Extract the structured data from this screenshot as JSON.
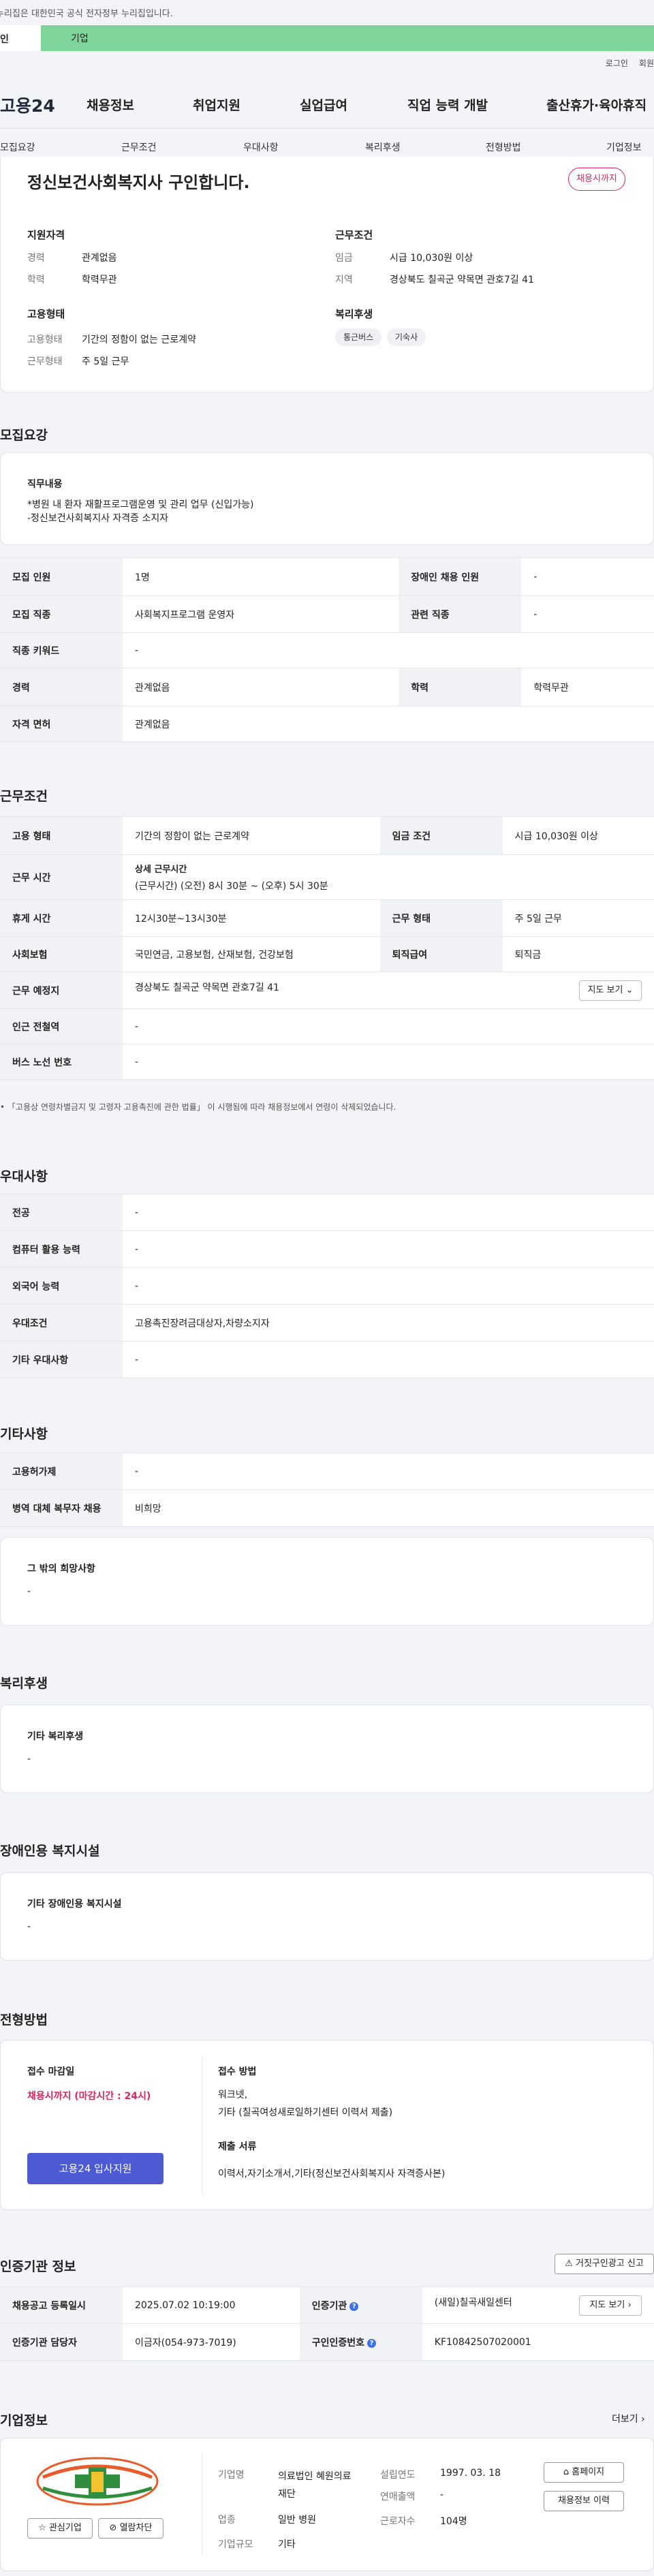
{
  "gov_banner": "이 누리집은 대한민국 공식 전자정부 누리집입니다.",
  "gov_banner_visible": "누리집은 대한민국 공식 전자정부 누리집입니다.",
  "top_tabs": [
    "인",
    "기업"
  ],
  "util": [
    "로그인",
    "회원"
  ],
  "logo": "고용24",
  "gnb": [
    "채용정보",
    "취업지원",
    "실업급여",
    "직업 능력 개발",
    "출산휴가·육아휴직"
  ],
  "subnav": [
    "모집요강",
    "근무조건",
    "우대사항",
    "복리후생",
    "전형방법",
    "기업정보"
  ],
  "title": "정신보건사회복지사 구인합니다.",
  "badge": "채용시까지",
  "summary": {
    "qual_title": "지원자격",
    "qual": [
      {
        "k": "경력",
        "v": "관계없음"
      },
      {
        "k": "학력",
        "v": "학력무관"
      }
    ],
    "cond_title": "근무조건",
    "cond": [
      {
        "k": "임금",
        "v": "시급 10,030원 이상"
      },
      {
        "k": "지역",
        "v": "경상북도 칠곡군 약목면 관호7길 41"
      }
    ],
    "type_title": "고용형태",
    "type": [
      {
        "k": "고용형태",
        "v": "기간의 정함이 없는 근로계약"
      },
      {
        "k": "근무형태",
        "v": "주 5일 근무"
      }
    ],
    "welfare_title": "복리후생",
    "welfare_chips": [
      "통근버스",
      "기숙사"
    ]
  },
  "recruit": {
    "section": "모집요강",
    "duty_title": "직무내용",
    "duty_lines": [
      "*병원 내 환자 재활프로그램운영 및 관리 업무 (신입가능)",
      "-정신보건사회복지사 자격증 소지자"
    ],
    "rows": [
      {
        "k1": "모집 인원",
        "v1": "1명",
        "k2": "장애인 채용 인원",
        "v2": "-"
      },
      {
        "k1": "모집 직종",
        "v1": "사회복지프로그램 운영자",
        "k2": "관련 직종",
        "v2": "-"
      },
      {
        "k1": "직종 키워드",
        "v1": "-"
      },
      {
        "k1": "경력",
        "v1": "관계없음",
        "k2": "학력",
        "v2": "학력무관"
      },
      {
        "k1": "자격 면허",
        "v1": "관계없음"
      }
    ]
  },
  "work": {
    "section": "근무조건",
    "r1": {
      "k1": "고용 형태",
      "v1": "기간의 정함이 없는 근로계약",
      "k2": "임금 조건",
      "v2": "시급 10,030원 이상"
    },
    "r2": {
      "k1": "근무 시간",
      "v1a": "상세 근무시간",
      "v1b": "(근무시간) (오전) 8시 30분 ~ (오후) 5시 30분"
    },
    "r3": {
      "k1": "휴게 시간",
      "v1": "12시30분~13시30분",
      "k2": "근무 형태",
      "v2": "주 5일 근무"
    },
    "r4": {
      "k1": "사회보험",
      "v1": "국민연금, 고용보험, 산재보험, 건강보험",
      "k2": "퇴직급여",
      "v2": "퇴직금"
    },
    "r5": {
      "k1": "근무 예정지",
      "v1": "경상북도 칠곡군 약목면 관호7길 41",
      "btn": "지도 보기"
    },
    "r6": {
      "k1": "인근 전철역",
      "v1": "-"
    },
    "r7": {
      "k1": "버스 노선 번호",
      "v1": "-"
    },
    "note": "「고용상 연령차별금지 및 고령자 고용촉진에 관한 법률」 이 시행됨에 따라 채용정보에서 연령이 삭제되었습니다."
  },
  "pref": {
    "section": "우대사항",
    "rows": [
      {
        "k": "전공",
        "v": "-"
      },
      {
        "k": "컴퓨터 활용 능력",
        "v": "-"
      },
      {
        "k": "외국어 능력",
        "v": "-"
      },
      {
        "k": "우대조건",
        "v": "고용촉진장려금대상자,차량소지자"
      },
      {
        "k": "기타 우대사항",
        "v": "-"
      }
    ]
  },
  "etc": {
    "section": "기타사항",
    "rows": [
      {
        "k": "고용허가제",
        "v": "-"
      },
      {
        "k": "병역 대체 복무자 채용",
        "v": "비희망"
      }
    ],
    "box_title": "그 밖의 희망사항",
    "box_value": "-"
  },
  "welfare": {
    "section": "복리후생",
    "box_title": "기타 복리후생",
    "box_value": "-"
  },
  "disab": {
    "section": "장애인용 복지시설",
    "box_title": "기타 장애인용 복지시설",
    "box_value": "-"
  },
  "process": {
    "section": "전형방법",
    "deadline_title": "접수 마감일",
    "deadline": "채용시까지 (마감시간 : 24시)",
    "apply_btn": "고용24 입사지원",
    "method_title": "접수 방법",
    "method1": "워크넷,",
    "method2": "기타 (칠곡여성새로일하기센터 이력서 제출)",
    "docs_title": "제출 서류",
    "docs": "이력서,자기소개서,기타(정신보건사회복지사 자격증사본)"
  },
  "agency": {
    "section": "인증기관 정보",
    "report_btn": "거짓구인광고 신고",
    "r1": {
      "k1": "채용공고 등록일시",
      "v1": "2025.07.02 10:19:00",
      "k2": "인증기관",
      "v2": "(새일)칠곡새일센터",
      "btn": "지도 보기"
    },
    "r2": {
      "k1": "인증기관 담당자",
      "v1": "이금자(054-973-7019)",
      "k2": "구인인증번호",
      "v2": "KF10842507020001"
    }
  },
  "company": {
    "section": "기업정보",
    "more": "더보기",
    "logo_text": "의료법인 혜원의료재단 일반병원",
    "btn_interest": "관심기업",
    "btn_block": "열람차단",
    "rows": [
      {
        "k": "기업명",
        "v": "의료법인 혜원의료재단"
      },
      {
        "k": "업종",
        "v": "일반 병원"
      },
      {
        "k": "기업규모",
        "v": "기타"
      }
    ],
    "rows2": [
      {
        "k": "설립연도",
        "v": "1997. 03. 18"
      },
      {
        "k": "연매출액",
        "v": "-"
      },
      {
        "k": "근로자수",
        "v": "104명"
      }
    ],
    "btn_home": "홈페이지",
    "btn_history": "채용정보 이력"
  },
  "colors": {
    "accent_green": "#7dd59b",
    "brand_blue": "#4c5bd4",
    "red": "#e0245e"
  }
}
